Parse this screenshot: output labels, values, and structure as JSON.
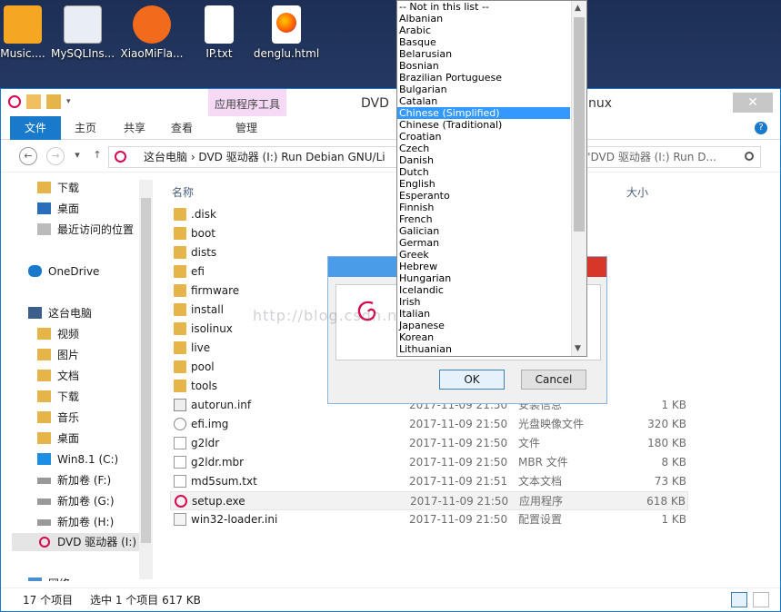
{
  "desktop": {
    "icons": [
      {
        "label": "Music....",
        "icon": "music-app-icon"
      },
      {
        "label": "MySQLIns...",
        "icon": "mysql-installer-icon"
      },
      {
        "label": "XiaoMiFla...",
        "icon": "xiaomi-flash-icon"
      },
      {
        "label": "IP.txt",
        "icon": "text-file-icon"
      },
      {
        "label": "denglu.html",
        "icon": "firefox-html-icon"
      }
    ]
  },
  "window": {
    "ctx_tool_tab": "应用程序工具",
    "title_left": "DVD",
    "title_right": "nux",
    "close": "✕",
    "ribbon_tabs": [
      "文件",
      "主页",
      "共享",
      "查看",
      "管理"
    ],
    "address": "这台电脑  ›  DVD 驱动器 (I:) Run Debian GNU/Li",
    "search_placeholder": "搜索\"DVD 驱动器 (I:) Run D...",
    "nav": {
      "back": "←",
      "forward": "→",
      "recent": "▾",
      "up": "↑"
    }
  },
  "sidebar": {
    "items": [
      {
        "label": "下载",
        "icon": "downloads-icon"
      },
      {
        "label": "桌面",
        "icon": "desktop-icon"
      },
      {
        "label": "最近访问的位置",
        "icon": "recent-places-icon"
      },
      {
        "label": "OneDrive",
        "icon": "onedrive-icon"
      },
      {
        "label": "这台电脑",
        "icon": "this-pc-icon"
      },
      {
        "label": "视频",
        "icon": "videos-icon"
      },
      {
        "label": "图片",
        "icon": "pictures-icon"
      },
      {
        "label": "文档",
        "icon": "documents-icon"
      },
      {
        "label": "下载",
        "icon": "downloads-icon"
      },
      {
        "label": "音乐",
        "icon": "music-icon"
      },
      {
        "label": "桌面",
        "icon": "desktop-icon"
      },
      {
        "label": "Win8.1 (C:)",
        "icon": "windows-drive-icon"
      },
      {
        "label": "新加卷 (F:)",
        "icon": "drive-icon"
      },
      {
        "label": "新加卷 (G:)",
        "icon": "drive-icon"
      },
      {
        "label": "新加卷 (H:)",
        "icon": "drive-icon"
      },
      {
        "label": "DVD 驱动器 (I:)",
        "icon": "debian-dvd-icon"
      },
      {
        "label": "网络",
        "icon": "network-icon"
      }
    ]
  },
  "file_list": {
    "headers": {
      "name": "名称",
      "size": "大小"
    },
    "rows": [
      {
        "name": ".disk",
        "date": "",
        "type": "",
        "size": "",
        "icon": "folder-icon"
      },
      {
        "name": "boot",
        "date": "",
        "type": "",
        "size": "",
        "icon": "folder-icon"
      },
      {
        "name": "dists",
        "date": "",
        "type": "",
        "size": "",
        "icon": "folder-icon"
      },
      {
        "name": "efi",
        "date": "",
        "type": "",
        "size": "",
        "icon": "folder-icon"
      },
      {
        "name": "firmware",
        "date": "",
        "type": "",
        "size": "",
        "icon": "folder-icon"
      },
      {
        "name": "install",
        "date": "",
        "type": "",
        "size": "",
        "icon": "folder-icon"
      },
      {
        "name": "isolinux",
        "date": "",
        "type": "",
        "size": "",
        "icon": "folder-icon"
      },
      {
        "name": "live",
        "date": "",
        "type": "",
        "size": "",
        "icon": "folder-icon"
      },
      {
        "name": "pool",
        "date": "",
        "type": "",
        "size": "",
        "icon": "folder-icon"
      },
      {
        "name": "tools",
        "date": "",
        "type": "",
        "size": "",
        "icon": "folder-icon"
      },
      {
        "name": "autorun.inf",
        "date": "2017-11-09 21:50",
        "type": "安装信息",
        "size": "1 KB",
        "icon": "inf-file-icon"
      },
      {
        "name": "efi.img",
        "date": "2017-11-09 21:50",
        "type": "光盘映像文件",
        "size": "320 KB",
        "icon": "disc-image-icon"
      },
      {
        "name": "g2ldr",
        "date": "2017-11-09 21:50",
        "type": "文件",
        "size": "180 KB",
        "icon": "file-icon"
      },
      {
        "name": "g2ldr.mbr",
        "date": "2017-11-09 21:50",
        "type": "MBR 文件",
        "size": "8 KB",
        "icon": "file-icon"
      },
      {
        "name": "md5sum.txt",
        "date": "2017-11-09 21:51",
        "type": "文本文档",
        "size": "73 KB",
        "icon": "text-file-icon"
      },
      {
        "name": "setup.exe",
        "date": "2017-11-09 21:50",
        "type": "应用程序",
        "size": "618 KB",
        "icon": "debian-exe-icon",
        "selected": true
      },
      {
        "name": "win32-loader.ini",
        "date": "2017-11-09 21:50",
        "type": "配置设置",
        "size": "1 KB",
        "icon": "ini-file-icon"
      }
    ]
  },
  "status": {
    "count": "17 个项目",
    "selected": "选中 1 个项目  617 KB"
  },
  "dialog": {
    "ok": "OK",
    "cancel": "Cancel"
  },
  "language_list": {
    "items": [
      "-- Not in this list --",
      "Albanian",
      "Arabic",
      "Basque",
      "Belarusian",
      "Bosnian",
      "Brazilian Portuguese",
      "Bulgarian",
      "Catalan",
      "Chinese (Simplified)",
      "Chinese (Traditional)",
      "Croatian",
      "Czech",
      "Danish",
      "Dutch",
      "English",
      "Esperanto",
      "Finnish",
      "French",
      "Galician",
      "German",
      "Greek",
      "Hebrew",
      "Hungarian",
      "Icelandic",
      "Irish",
      "Italian",
      "Japanese",
      "Korean",
      "Lithuanian"
    ],
    "highlighted": "Chinese (Simplified)"
  },
  "watermark": "http://blog.csdn.net/qq_32261191",
  "colors": {
    "accent": "#1979ca",
    "highlight": "#3399ff",
    "debian_red": "#d70751"
  }
}
